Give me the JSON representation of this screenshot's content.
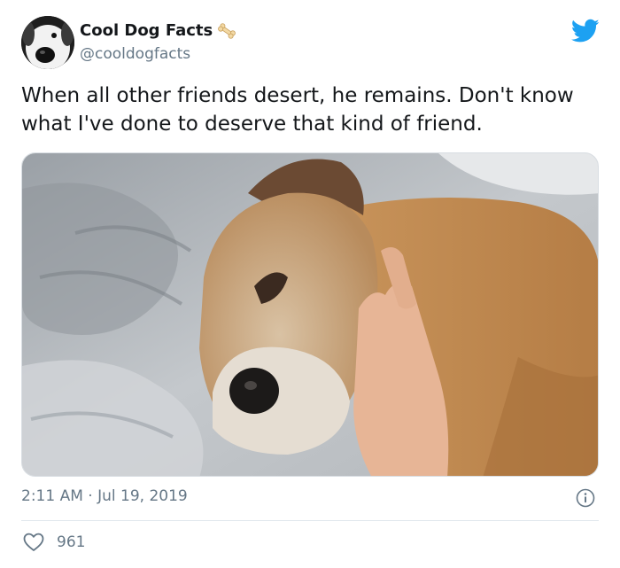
{
  "author": {
    "display_name": "Cool Dog Facts",
    "handle": "@cooldogfacts",
    "avatar_icon": "dog-avatar",
    "badge_icon": "bone-icon"
  },
  "tweet": {
    "text": "When all other friends desert, he remains. Don't know what I've done to deserve that kind of friend.",
    "media_icon": "sleeping-dog-photo"
  },
  "meta": {
    "timestamp": "2:11 AM · Jul 19, 2019"
  },
  "stats": {
    "likes": "961"
  },
  "colors": {
    "twitter_blue": "#1da1f2",
    "secondary_text": "#657786",
    "primary_text": "#14171a"
  }
}
